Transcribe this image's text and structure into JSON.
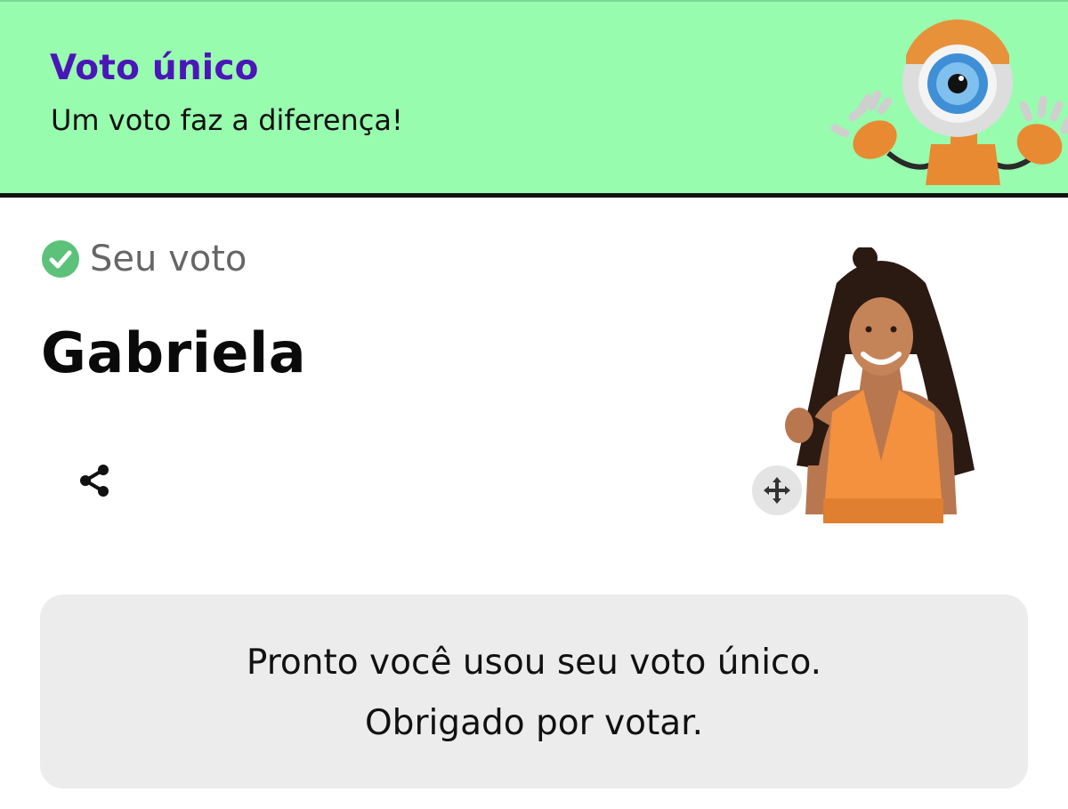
{
  "banner": {
    "title": "Voto único",
    "subtitle": "Um voto faz a diferença!",
    "background_color": "#98fcae",
    "title_color": "#4a16b8",
    "mascot_icon": "big-brother-eye-mascot"
  },
  "vote": {
    "status_icon": "check-circle-icon",
    "status_color": "#5cc27a",
    "label": "Seu voto",
    "candidate_name": "Gabriela",
    "share_icon": "share-icon",
    "move_icon": "move-arrows-icon"
  },
  "message": {
    "line1": "Pronto você usou seu voto único.",
    "line2": "Obrigado por votar."
  }
}
